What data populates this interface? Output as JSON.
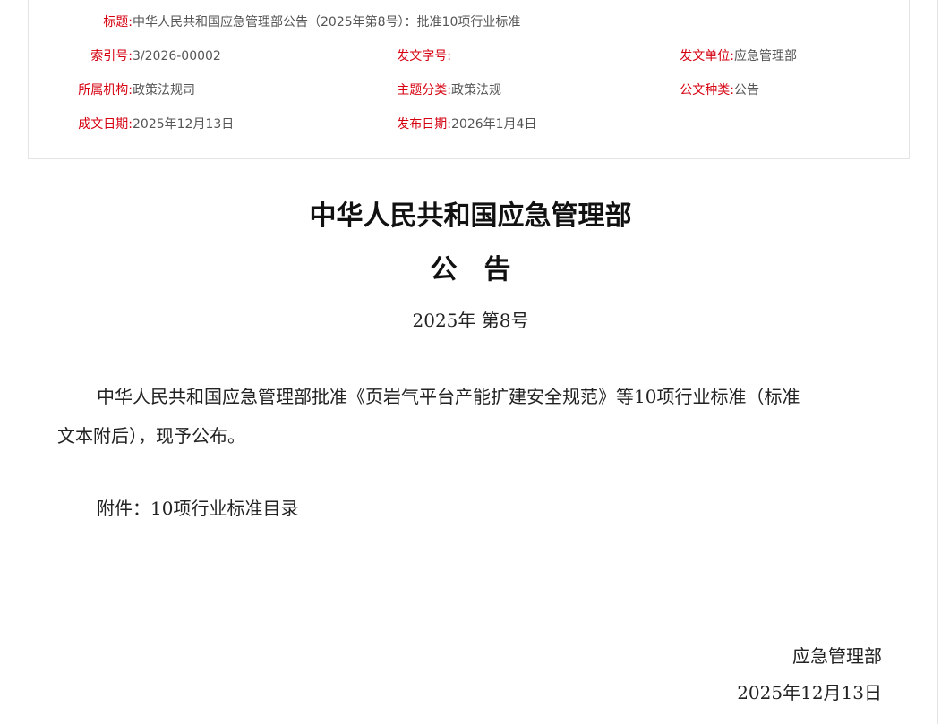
{
  "meta": {
    "title_label": "标题:",
    "title_value": "中华人民共和国应急管理部公告（2025年第8号）：批准10项行业标准",
    "index_label": "索引号:",
    "index_value": "3/2026-00002",
    "docno_label": "发文字号:",
    "docno_value": "",
    "issuer_label": "发文单位:",
    "issuer_value": "应急管理部",
    "org_label": "所属机构:",
    "org_value": "政策法规司",
    "topic_label": "主题分类:",
    "topic_value": "政策法规",
    "kind_label": "公文种类:",
    "kind_value": "公告",
    "created_label": "成文日期:",
    "created_value": "2025年12月13日",
    "published_label": "发布日期:",
    "published_value": "2026年1月4日"
  },
  "document": {
    "heading_main": "中华人民共和国应急管理部",
    "heading_sub": "公　告",
    "number": "2025年  第8号",
    "body_line1": "中华人民共和国应急管理部批准《页岩气平台产能扩建安全规范》等10项行业标准（标准",
    "body_line2": "文本附后），现予公布。",
    "attachment": "附件：10项行业标准目录",
    "signature_org": "应急管理部",
    "signature_date": "2025年12月13日"
  }
}
